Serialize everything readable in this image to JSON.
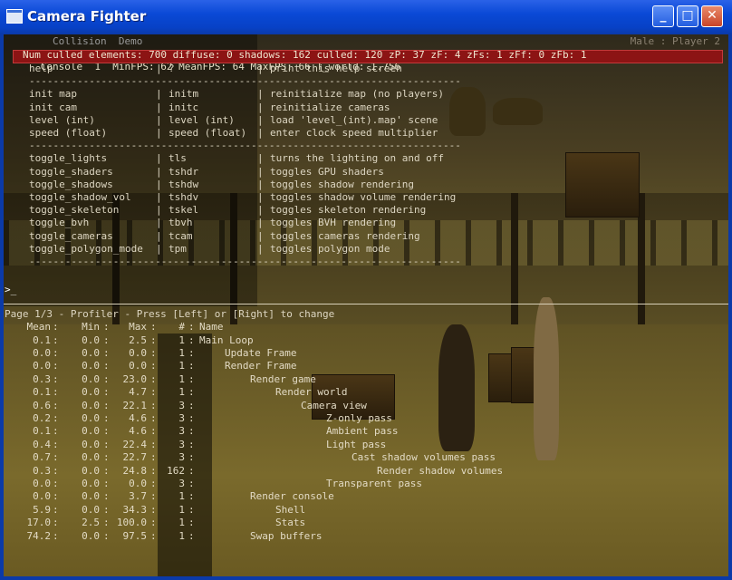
{
  "window": {
    "title": "Camera Fighter",
    "minimize_icon": "minimize-icon",
    "maximize_icon": "maximize-icon",
    "close_icon": "close-icon",
    "accent": "#0a49d6"
  },
  "hud": {
    "stats_line": "Console  1  MinFPS: 62 MeanFPS: 64 MaxFPS: 66 T_world: 1.756",
    "stats_under": "        Collision  Demo",
    "player_label": "Male : Player 2",
    "cull_line": "Num culled elements: 700 diffuse: 0 shadows: 162 culled: 120 zP: 37 zF: 4 zFs: 1 zFf: 0 zFb: 1",
    "cull_bar_color": "#8c1414"
  },
  "help": {
    "rows": [
      {
        "name": "help",
        "short": "?",
        "desc": "print this help screen"
      },
      {
        "divider": "------------------------------------------------------------------------"
      },
      {
        "name": "init map",
        "short": "initm",
        "desc": "reinitialize map (no players)"
      },
      {
        "name": "init cam",
        "short": "initc",
        "desc": "reinitialize cameras"
      },
      {
        "name": "level (int)",
        "short": "level (int)",
        "desc": "load 'level_(int).map' scene"
      },
      {
        "name": "speed (float)",
        "short": "speed (float)",
        "desc": "enter clock speed multiplier"
      },
      {
        "divider": "------------------------------------------------------------------------"
      },
      {
        "name": "toggle_lights",
        "short": "tls",
        "desc": "turns the lighting on and off"
      },
      {
        "name": "toggle_shaders",
        "short": "tshdr",
        "desc": "toggles GPU shaders"
      },
      {
        "name": "toggle_shadows",
        "short": "tshdw",
        "desc": "toggles shadow rendering"
      },
      {
        "name": "toggle_shadow_vol",
        "short": "tshdv",
        "desc": "toggles shadow volume rendering"
      },
      {
        "name": "toggle_skeleton",
        "short": "tskel",
        "desc": "toggles skeleton rendering"
      },
      {
        "name": "toggle_bvh",
        "short": "tbvh",
        "desc": "toggles BVH rendering"
      },
      {
        "name": "toggle_cameras",
        "short": "tcam",
        "desc": "toggles cameras rendering"
      },
      {
        "name": "toggle_polygon_mode",
        "short": "tpm",
        "desc": "toggles polygon mode"
      },
      {
        "divider": "------------------------------------------------------------------------"
      }
    ],
    "separator": "|"
  },
  "console": {
    "prompt": ">_"
  },
  "profiler": {
    "header": "Page 1/3 - Profiler - Press [Left] or [Right] to change",
    "columns": {
      "mean": "Mean",
      "min": "Min",
      "max": "Max",
      "num": "#",
      "name": "Name"
    },
    "separator": ":",
    "rows": [
      {
        "mean": "0.1",
        "min": "0.0",
        "max": "2.5",
        "num": "1",
        "name": "Main Loop",
        "indent": 0
      },
      {
        "mean": "0.0",
        "min": "0.0",
        "max": "0.0",
        "num": "1",
        "name": "Update Frame",
        "indent": 1
      },
      {
        "mean": "0.0",
        "min": "0.0",
        "max": "0.0",
        "num": "1",
        "name": "Render Frame",
        "indent": 1
      },
      {
        "mean": "0.3",
        "min": "0.0",
        "max": "23.0",
        "num": "1",
        "name": "Render game",
        "indent": 2
      },
      {
        "mean": "0.1",
        "min": "0.0",
        "max": "4.7",
        "num": "1",
        "name": "Render world",
        "indent": 3
      },
      {
        "mean": "0.6",
        "min": "0.0",
        "max": "22.1",
        "num": "3",
        "name": "Camera view",
        "indent": 4
      },
      {
        "mean": "0.2",
        "min": "0.0",
        "max": "4.6",
        "num": "3",
        "name": "Z-only pass",
        "indent": 5
      },
      {
        "mean": "0.1",
        "min": "0.0",
        "max": "4.6",
        "num": "3",
        "name": "Ambient pass",
        "indent": 5
      },
      {
        "mean": "0.4",
        "min": "0.0",
        "max": "22.4",
        "num": "3",
        "name": "Light pass",
        "indent": 5
      },
      {
        "mean": "0.7",
        "min": "0.0",
        "max": "22.7",
        "num": "3",
        "name": "Cast shadow volumes pass",
        "indent": 6
      },
      {
        "mean": "0.3",
        "min": "0.0",
        "max": "24.8",
        "num": "162",
        "name": "Render shadow volumes",
        "indent": 7
      },
      {
        "mean": "0.0",
        "min": "0.0",
        "max": "0.0",
        "num": "3",
        "name": "Transparent pass",
        "indent": 5
      },
      {
        "mean": "0.0",
        "min": "0.0",
        "max": "3.7",
        "num": "1",
        "name": "Render console",
        "indent": 2
      },
      {
        "mean": "5.9",
        "min": "0.0",
        "max": "34.3",
        "num": "1",
        "name": "Shell",
        "indent": 3
      },
      {
        "mean": "17.0",
        "min": "2.5",
        "max": "100.0",
        "num": "1",
        "name": "Stats",
        "indent": 3
      },
      {
        "mean": "74.2",
        "min": "0.0",
        "max": "97.5",
        "num": "1",
        "name": "Swap buffers",
        "indent": 2
      }
    ]
  }
}
